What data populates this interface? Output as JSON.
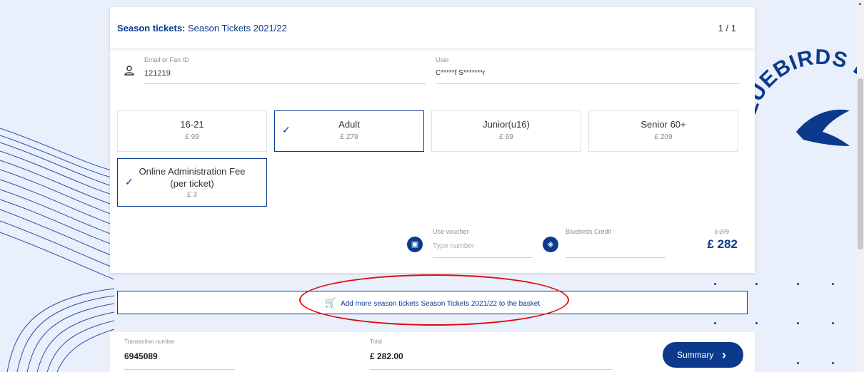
{
  "header": {
    "title_bold": "Season tickets:",
    "title_rest": "Season Tickets 2021/22",
    "page_count": "1 / 1"
  },
  "fan": {
    "email_label": "Email or Fan ID",
    "email_value": "121219",
    "user_label": "User",
    "user_value": "C*****f S*******r"
  },
  "options": [
    {
      "name": "16-21",
      "price": "£ 99",
      "selected": false
    },
    {
      "name": "Adult",
      "price": "£ 279",
      "selected": true
    },
    {
      "name": "Junior(u16)",
      "price": "£ 69",
      "selected": false
    },
    {
      "name": "Senior 60+",
      "price": "£ 209",
      "selected": false
    },
    {
      "name": "Online Administration Fee (per ticket)",
      "price": "£ 3",
      "selected": true
    }
  ],
  "voucher": {
    "label": "Use voucher",
    "placeholder": "Type number",
    "credit_label": "Bluebirds Credit"
  },
  "pricing": {
    "old_price": "£ 279",
    "total": "£ 282"
  },
  "basket": {
    "add_label": "Add more season tickets Season Tickets 2021/22 to the basket"
  },
  "footer": {
    "transaction_label": "Transaction number",
    "transaction_value": "6945089",
    "total_label": "Total",
    "total_value": "£ 282.00",
    "summary_label": "Summary"
  },
  "brand": {
    "circle_text": "BLUEBIRDS BLUEBIRDS",
    "accent": "#0b3a8c",
    "highlight": "#e10b0b"
  },
  "icons": {
    "user": "user-icon",
    "voucher": "voucher-icon",
    "credit": "tag-icon",
    "cart": "cart-icon",
    "check": "checkmark-icon",
    "next": "chevron-right-icon"
  }
}
